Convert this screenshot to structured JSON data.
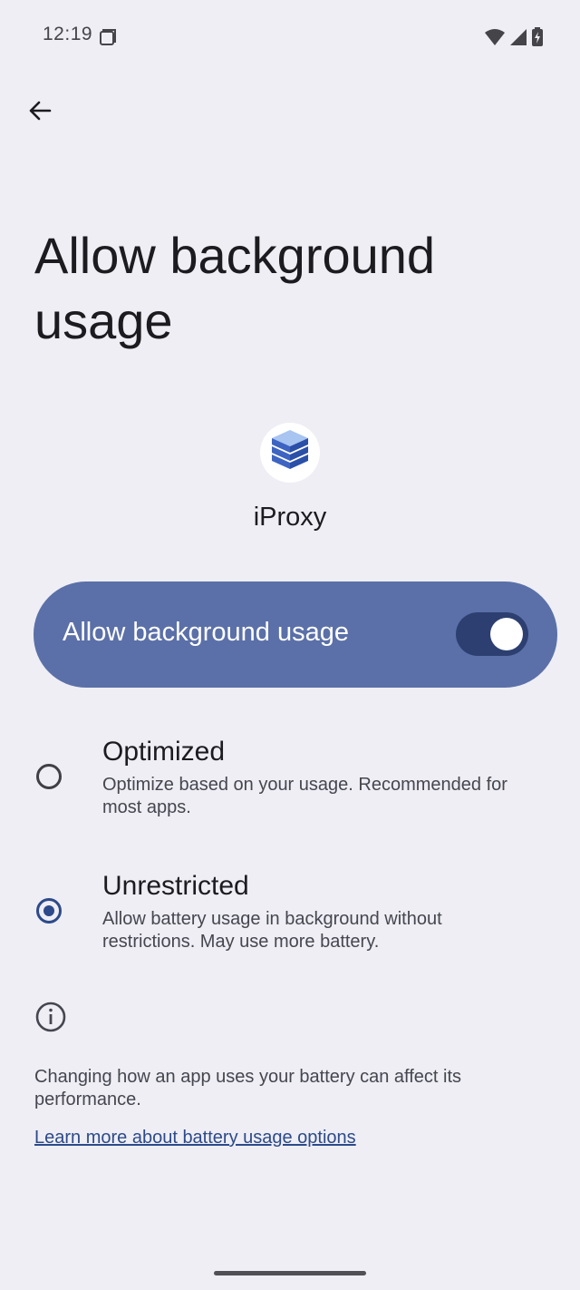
{
  "status_bar": {
    "time": "12:19",
    "icons": [
      "screenshot-icon",
      "wifi-icon",
      "cellular-icon",
      "battery-charging-icon"
    ]
  },
  "header": {
    "back_icon": "arrow-back-icon",
    "title": "Allow background usage"
  },
  "app": {
    "icon": "server-stack-icon",
    "name": "iProxy"
  },
  "toggle": {
    "label": "Allow background usage",
    "on": true
  },
  "options": [
    {
      "title": "Optimized",
      "description": "Optimize based on your usage. Recommended for most apps.",
      "selected": false
    },
    {
      "title": "Unrestricted",
      "description": "Allow battery usage in background without restrictions. May use more battery.",
      "selected": true
    }
  ],
  "footer": {
    "info_icon": "info-icon",
    "text": "Changing how an app uses your battery can affect its performance.",
    "link": "Learn more about battery usage options"
  },
  "colors": {
    "background": "#eeeef4",
    "toggle_card": "#5b70a8",
    "accent": "#2d4a8a"
  }
}
